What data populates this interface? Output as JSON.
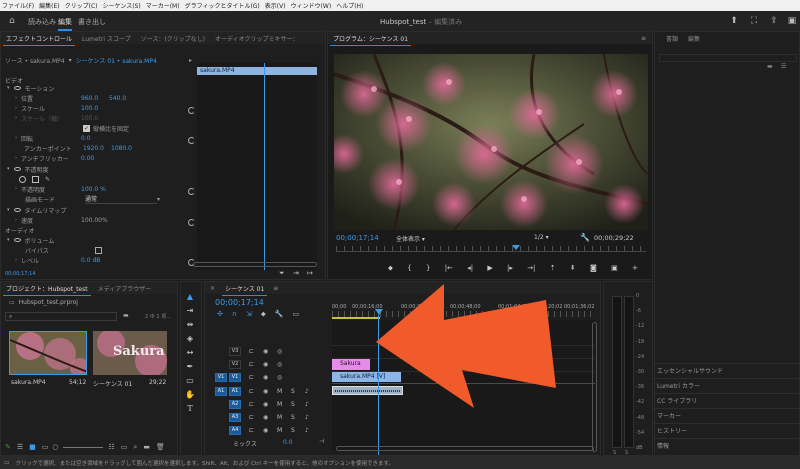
{
  "menubar": [
    "ファイル(F)",
    "編集(E)",
    "クリップ(C)",
    "シーケンス(S)",
    "マーカー(M)",
    "グラフィックとタイトル(G)",
    "表示(V)",
    "ウィンドウ(W)",
    "ヘルプ(H)"
  ],
  "workspace": {
    "tabs": [
      "読み込み",
      "編集",
      "書き出し"
    ],
    "active": "編集",
    "project": "Hubspot_test",
    "state": "編集済み"
  },
  "effect_controls": {
    "tabs": [
      "エフェクトコントロール",
      "Lumetri スコープ",
      "ソース：(クリップなし)",
      "オーディオクリップミキサー："
    ],
    "source": "ソース • sakura.MP4",
    "sequence": "シーケンス 01 • sakura.MP4",
    "clip_label": "sakura.MP4",
    "sections": {
      "video": "ビデオ",
      "audio": "オーディオ"
    },
    "motion": "モーション",
    "position_label": "位置",
    "position_x": "960.0",
    "position_y": "540.0",
    "scale_label": "スケール",
    "scale_value": "100.0",
    "scale_width_label": "スケール（幅）",
    "scale_width_value": "100.0",
    "uniform_scale": "縦横比を固定",
    "rotation_label": "回転",
    "rotation_value": "0.0",
    "anchor_label": "アンカーポイント",
    "anchor_x": "1920.0",
    "anchor_y": "1080.0",
    "flicker_label": "アンチフリッカー",
    "flicker_value": "0.00",
    "opacity_section": "不透明度",
    "opacity_label": "不透明度",
    "opacity_value": "100.0 %",
    "blend_label": "描画モード",
    "blend_value": "通常",
    "time_remap": "タイムリマップ",
    "speed_label": "速度",
    "speed_value": "100.00%",
    "volume": "ボリューム",
    "bypass_label": "バイパス",
    "level_label": "レベル",
    "level_value": "0.0 dB",
    "timecode": "00;00;17;14"
  },
  "program": {
    "tab": "プログラム：シーケンス 01",
    "timecode": "00;00;17;14",
    "fit": "全体表示",
    "resolution": "1/2",
    "duration": "00;00;29;22"
  },
  "right_panel": {
    "tabs": [
      "書類",
      "編集"
    ],
    "items": [
      "エッセンシャルサウンド",
      "Lumetri カラー",
      "CC ライブラリ",
      "マーカー",
      "ヒストリー",
      "情報"
    ]
  },
  "project": {
    "tabs": [
      "プロジェクト：Hubspot_test",
      "メディアブラウザー"
    ],
    "file": "Hubspot_test.prproj",
    "selection": "2 中 1 項...",
    "items": [
      {
        "name": "sakura.MP4",
        "duration": "54;12"
      },
      {
        "name": "シーケンス 01",
        "duration": "29;22",
        "thumb_text": "Sakura"
      }
    ]
  },
  "timeline": {
    "tab": "シーケンス 01",
    "timecode": "00;00;17;14",
    "ruler": [
      "00;00",
      "00;00;16;00",
      "00;00;32;00",
      "00;00;48;00",
      "00;01;04;02",
      "00;01;20;02",
      "00;01;36;02"
    ],
    "video_tracks": [
      "V3",
      "V2",
      "V1"
    ],
    "audio_tracks": [
      "A1",
      "A2",
      "A3",
      "A4"
    ],
    "mix_label": "ミックス",
    "mix_value": "0.0",
    "clips": {
      "title": "Sakura",
      "video": "sakura.MP4 [V]"
    }
  },
  "meter": {
    "labels": [
      "0",
      "-6",
      "-12",
      "-18",
      "-24",
      "-30",
      "-36",
      "-42",
      "-48",
      "-54",
      "dB"
    ]
  },
  "status": "クリックで選択、または空き領域をドラッグして囲んだ選択を選択します。Shift、Alt、および Ctrl キーを使用すると、他のオプションを使用できます。",
  "colors": {
    "accent": "#2d8ceb",
    "arrow": "#f15a2b",
    "title_clip": "#e38de8",
    "video_clip": "#8db5e8"
  }
}
